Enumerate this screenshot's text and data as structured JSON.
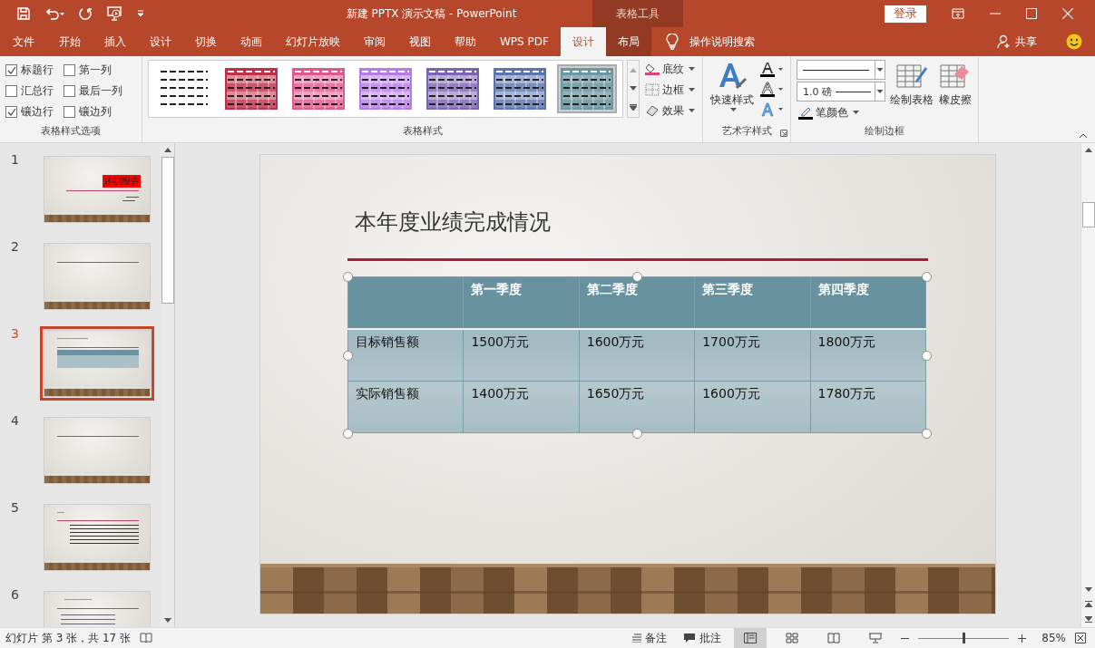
{
  "window": {
    "title": "新建 PPTX 演示文稿  -  PowerPoint",
    "context_tab": "表格工具",
    "login": "登录"
  },
  "tabs": [
    {
      "label": "文件",
      "selected": false
    },
    {
      "label": "开始",
      "selected": false
    },
    {
      "label": "插入",
      "selected": false
    },
    {
      "label": "设计",
      "selected": false
    },
    {
      "label": "切换",
      "selected": false
    },
    {
      "label": "动画",
      "selected": false
    },
    {
      "label": "幻灯片放映",
      "selected": false
    },
    {
      "label": "审阅",
      "selected": false
    },
    {
      "label": "视图",
      "selected": false
    },
    {
      "label": "帮助",
      "selected": false
    },
    {
      "label": "WPS PDF",
      "selected": false
    },
    {
      "label": "设计",
      "selected": true
    },
    {
      "label": "布局",
      "selected": false
    }
  ],
  "tell_me": "操作说明搜索",
  "share": "共享",
  "ribbon": {
    "style_options": {
      "label": "表格样式选项",
      "checkboxes": [
        {
          "label": "标题行",
          "checked": true
        },
        {
          "label": "第一列",
          "checked": false
        },
        {
          "label": "汇总行",
          "checked": false
        },
        {
          "label": "最后一列",
          "checked": false
        },
        {
          "label": "镶边行",
          "checked": true
        },
        {
          "label": "镶边列",
          "checked": false
        }
      ]
    },
    "table_styles": {
      "label": "表格样式",
      "styles": [
        {
          "kind": "plain",
          "color": "#222222",
          "selected": false
        },
        {
          "kind": "banded",
          "color": "#c0304a",
          "selected": false
        },
        {
          "kind": "banded",
          "color": "#e2588e",
          "selected": false
        },
        {
          "kind": "banded",
          "color": "#b77be6",
          "selected": false
        },
        {
          "kind": "banded",
          "color": "#7c64b2",
          "selected": false
        },
        {
          "kind": "banded",
          "color": "#5b73ae",
          "selected": false
        },
        {
          "kind": "banded",
          "color": "#6a98a2",
          "selected": true
        }
      ],
      "commands": [
        "底纹",
        "边框",
        "效果"
      ]
    },
    "wordart": {
      "label": "艺术字样式",
      "quick_styles": "快速样式"
    },
    "draw_borders": {
      "label": "绘制边框",
      "pen_weight": "1.0 磅",
      "pen_color": "笔颜色",
      "draw_table": "绘制表格",
      "eraser": "橡皮擦"
    }
  },
  "slides": [
    {
      "number": "1",
      "kind": "title",
      "text": "述职报告",
      "selected": false
    },
    {
      "number": "2",
      "kind": "line",
      "selected": false
    },
    {
      "number": "3",
      "kind": "table",
      "selected": true
    },
    {
      "number": "4",
      "kind": "line",
      "selected": false
    },
    {
      "number": "5",
      "kind": "text",
      "selected": false
    },
    {
      "number": "6",
      "kind": "list",
      "selected": false
    }
  ],
  "slide": {
    "title": "本年度业绩完成情况",
    "table": {
      "columns": [
        "",
        "第一季度",
        "第二季度",
        "第三季度",
        "第四季度"
      ],
      "rows": [
        [
          "目标销售额",
          "1500万元",
          "1600万元",
          "1700万元",
          "1800万元"
        ],
        [
          "实际销售额",
          "1400万元",
          "1650万元",
          "1600万元",
          "1780万元"
        ]
      ]
    }
  },
  "status_bar": {
    "slide_info": "幻灯片 第 3 张，共 17 张",
    "notes": "备注",
    "comments": "批注",
    "zoom": "85%",
    "zoom_level": {
      "level": 0.5
    }
  }
}
